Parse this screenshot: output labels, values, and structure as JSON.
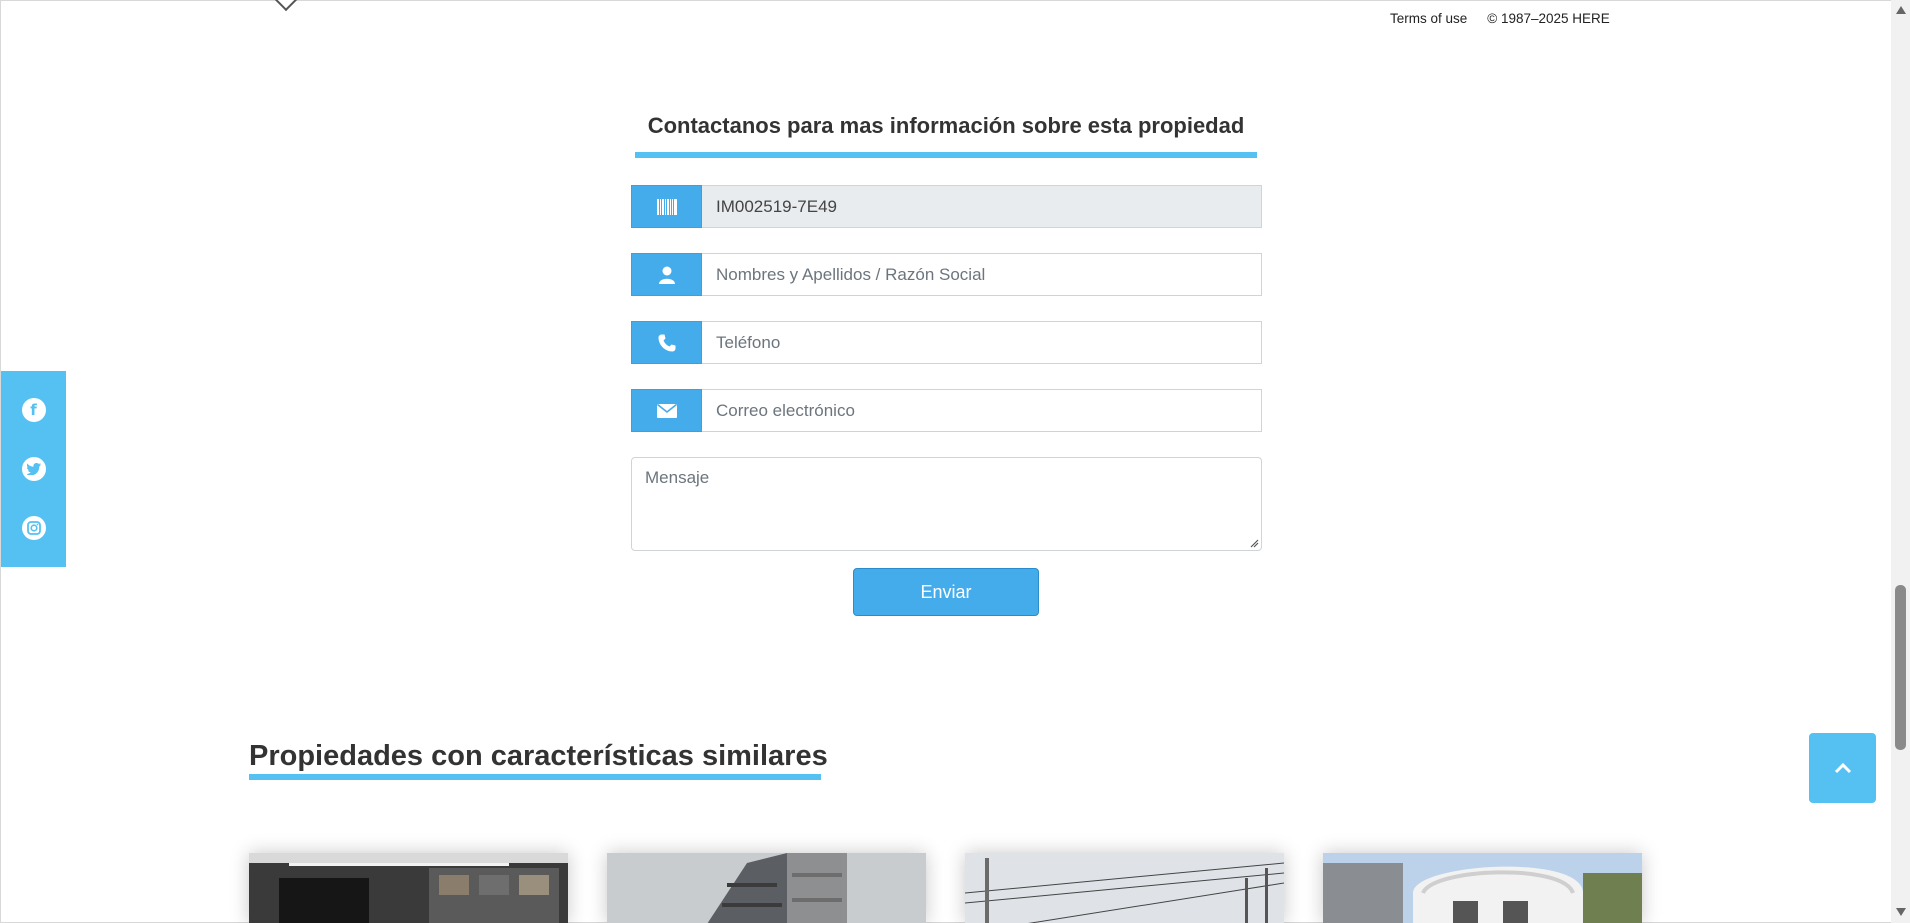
{
  "map": {
    "terms_label": "Terms of use",
    "copyright": "© 1987–2025 HERE"
  },
  "contact": {
    "title": "Contactanos para mas información sobre esta propiedad",
    "code_value": "IM002519-7E49",
    "name_placeholder": "Nombres y Apellidos / Razón Social",
    "phone_placeholder": "Teléfono",
    "email_placeholder": "Correo electrónico",
    "message_placeholder": "Mensaje",
    "send_label": "Enviar"
  },
  "icons": {
    "code": "barcode-icon",
    "name": "user-icon",
    "phone": "phone-icon",
    "email": "envelope-icon",
    "facebook": "facebook-icon",
    "twitter": "twitter-icon",
    "instagram": "instagram-icon",
    "back_top": "chevron-up-icon"
  },
  "similar": {
    "title": "Propiedades con características similares"
  },
  "colors": {
    "accent": "#55c1f3",
    "button": "#45acec"
  }
}
